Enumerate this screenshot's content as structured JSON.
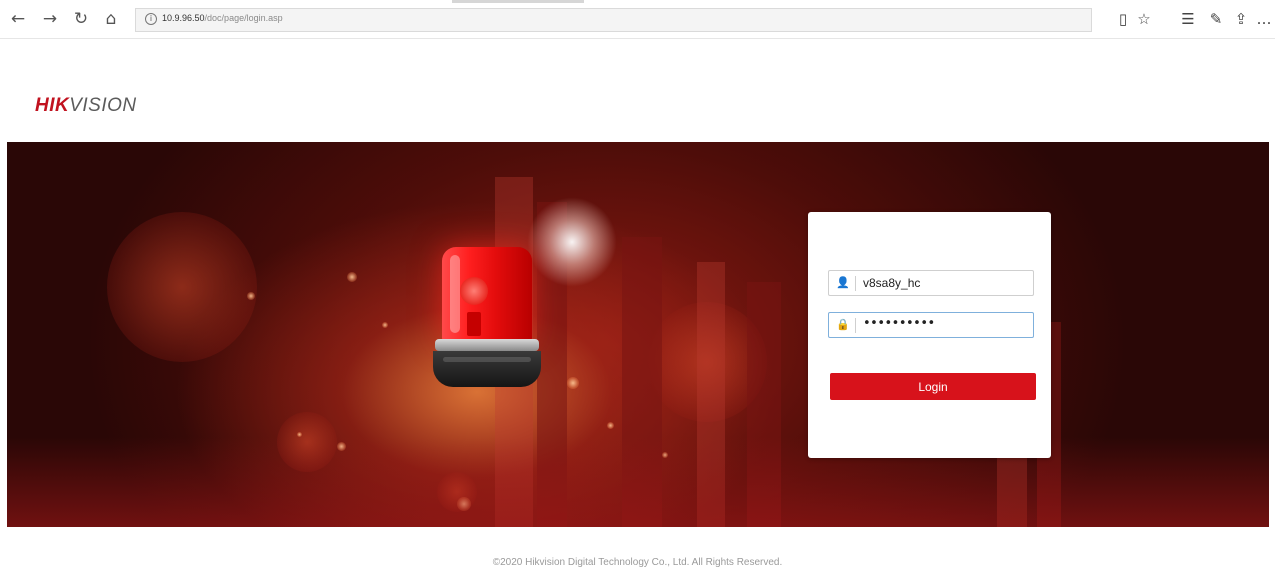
{
  "browser": {
    "address_host": "10.9.96.50",
    "address_path": "/doc/page/login.asp"
  },
  "logo": {
    "part1": "HIK",
    "part2": "VISION"
  },
  "login": {
    "username_value": "v8sa8y_hc",
    "password_mask": "••••••••••",
    "button_label": "Login"
  },
  "footer": {
    "copyright": "©2020 Hikvision Digital Technology Co., Ltd. All Rights Reserved."
  },
  "colors": {
    "brand_red": "#d7121b",
    "logo_red": "#c1121f"
  }
}
